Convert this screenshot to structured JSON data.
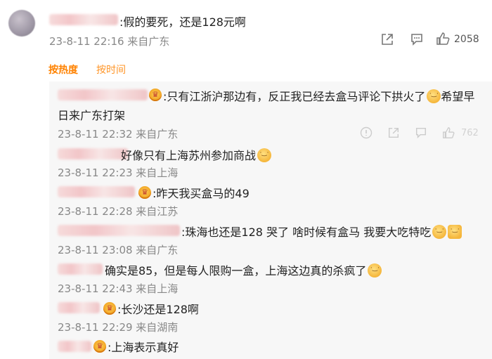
{
  "main": {
    "text": ":假的要死，还是128元啊",
    "meta": "23-8-11 22:16 来自广东",
    "likes": "2058"
  },
  "sort_tabs": [
    "按热度",
    "按时间"
  ],
  "replies": [
    {
      "text_line1": ":只有江浙沪那边有，反正我已经去盒马评论下拱火了",
      "text_after_emoji": "希望早",
      "text_line2": "日来广东打架",
      "meta": "23-8-11 22:32 来自广东",
      "count": "762"
    },
    {
      "text": "好像只有上海苏州参加商战",
      "meta": "23-8-11 22:23 来自上海"
    },
    {
      "text": ":昨天我买盒马的49",
      "meta": "23-8-11 22:28 来自江苏"
    },
    {
      "text": ":珠海也还是128 哭了 啥时候有盒马 我要大吃特吃",
      "meta": "23-8-11 23:08 来自广东"
    },
    {
      "text": "确实是85，但是每人限购一盒，上海这边真的杀疯了",
      "meta": "23-8-11 22:43 来自上海"
    },
    {
      "text": ":长沙还是128啊",
      "meta": "23-8-11 22:29 来自湖南"
    },
    {
      "text": ":上海表示真好"
    }
  ]
}
